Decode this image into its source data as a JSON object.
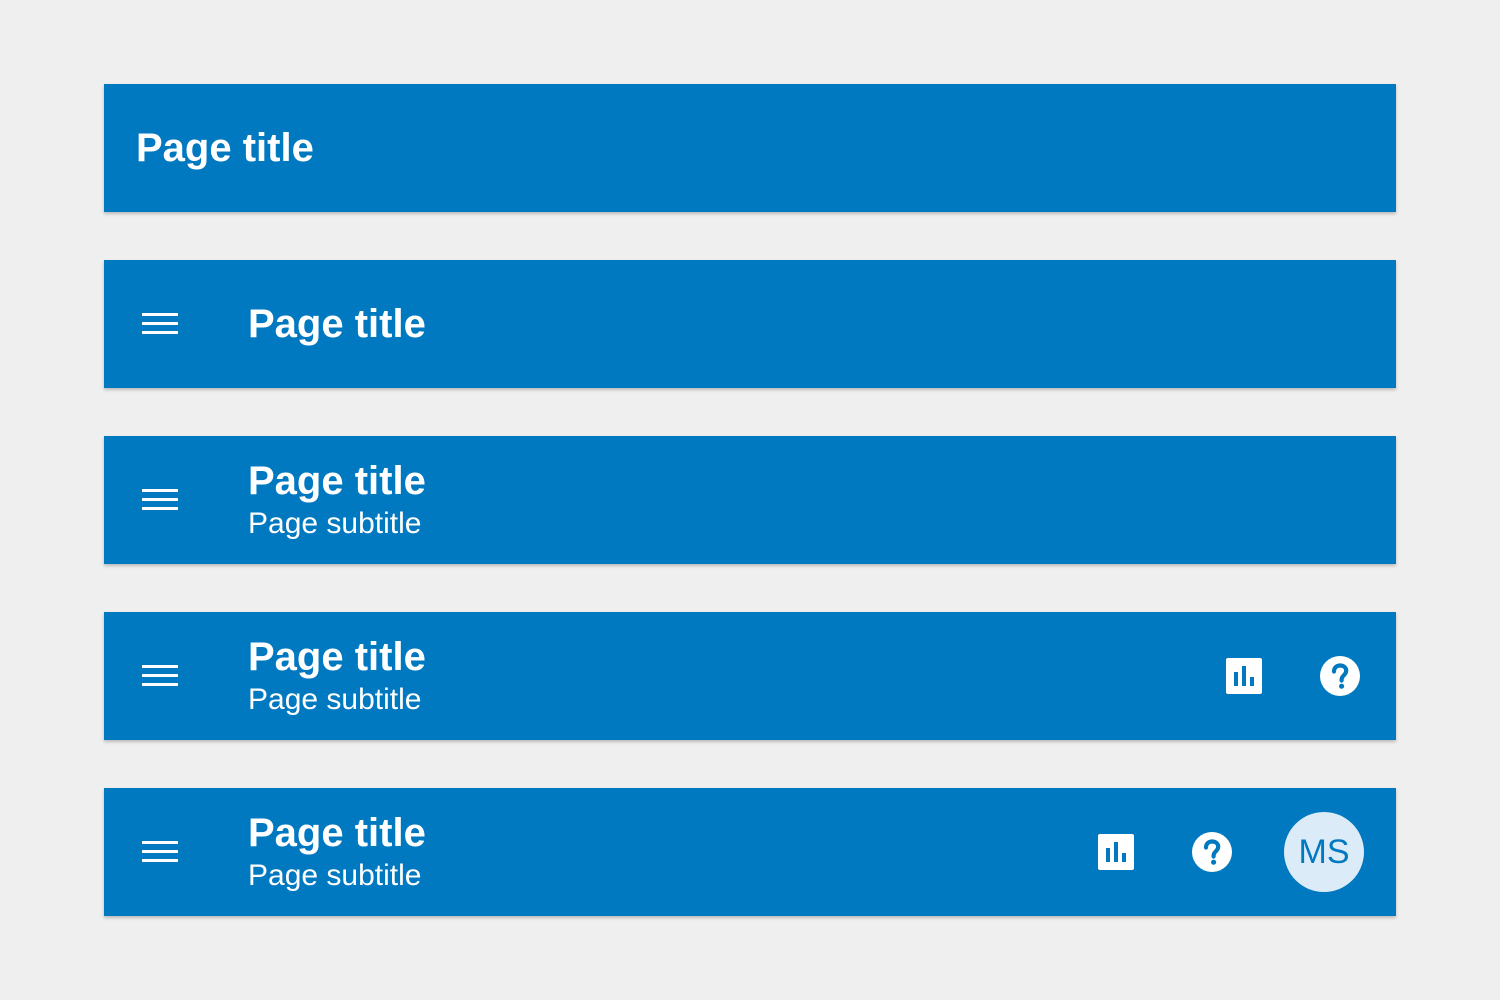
{
  "colors": {
    "background": "#efefef",
    "app_bar": "#0079c1",
    "on_bar": "#ffffff",
    "avatar_bg": "#dcebf8",
    "avatar_text": "#0079c1"
  },
  "bars": [
    {
      "title": "Page title"
    },
    {
      "menu_icon": "menu-icon",
      "title": "Page title"
    },
    {
      "menu_icon": "menu-icon",
      "title": "Page title",
      "subtitle": "Page subtitle"
    },
    {
      "menu_icon": "menu-icon",
      "title": "Page title",
      "subtitle": "Page subtitle",
      "actions": [
        "bar-chart-icon",
        "help-icon"
      ]
    },
    {
      "menu_icon": "menu-icon",
      "title": "Page title",
      "subtitle": "Page subtitle",
      "actions": [
        "bar-chart-icon",
        "help-icon"
      ],
      "avatar_initials": "MS"
    }
  ]
}
